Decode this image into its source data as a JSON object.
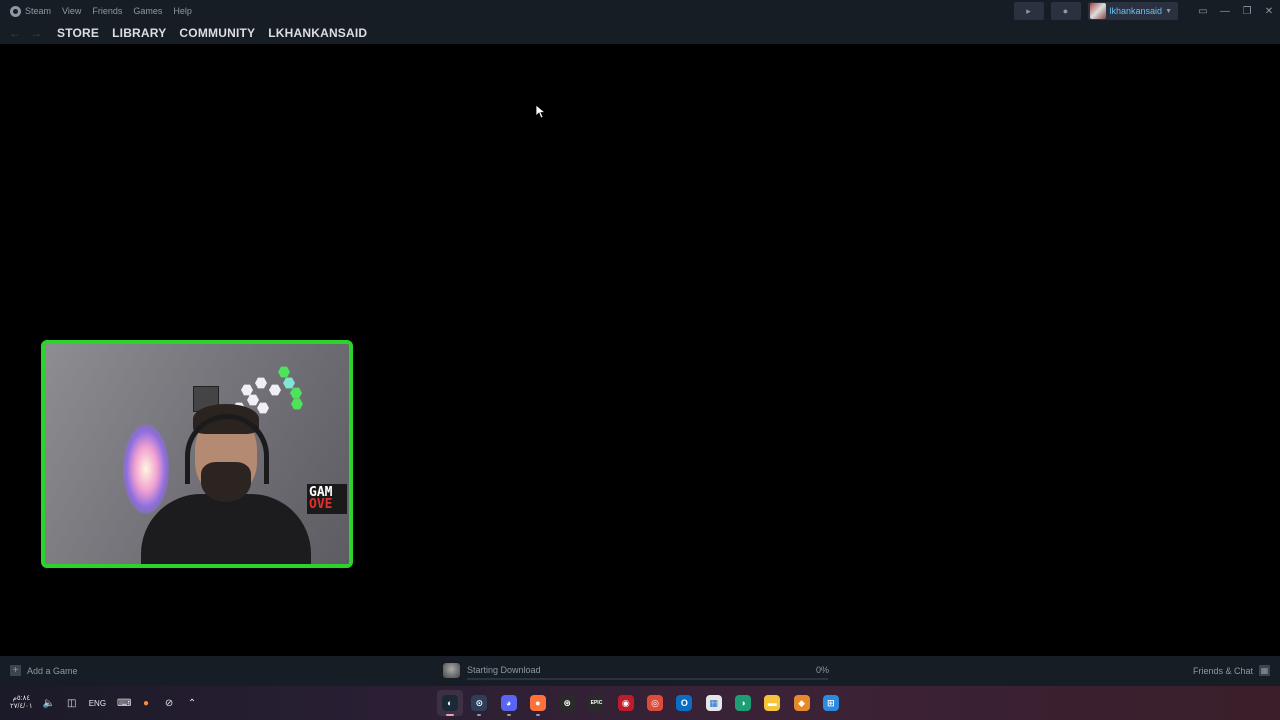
{
  "menubar": {
    "app_name": "Steam",
    "items": [
      "View",
      "Friends",
      "Games",
      "Help"
    ],
    "account_name": "lkhankansaid",
    "icons": [
      "megaphone-icon",
      "bell-icon",
      "big-picture-icon",
      "minimize-icon",
      "maximize-icon",
      "close-icon"
    ]
  },
  "navbar": {
    "back_icon": "←",
    "forward_icon": "→",
    "links": [
      "STORE",
      "LIBRARY",
      "COMMUNITY",
      "LKHANKANSAID"
    ]
  },
  "webcam": {
    "sign_line1": "GAM",
    "sign_line2": "OVE",
    "border_color": "#2bd42b"
  },
  "statusbar": {
    "add_game_label": "Add a Game",
    "download_label": "Starting Download",
    "download_percent": "0%",
    "download_progress": 0,
    "friends_label": "Friends & Chat"
  },
  "taskbar": {
    "clock_line1": "٥:٨٤م",
    "clock_line2": "٢٧/٤/٠١",
    "language": "ENG",
    "apps": [
      {
        "name": "steam",
        "color": "#1b2838",
        "glyph": "◐",
        "state": "active"
      },
      {
        "name": "controller",
        "color": "#2f3f5a",
        "glyph": "⊙",
        "state": "open"
      },
      {
        "name": "discord",
        "color": "#5865f2",
        "glyph": "◕",
        "state": "open"
      },
      {
        "name": "firefox",
        "color": "#ff7139",
        "glyph": "●",
        "state": "open"
      },
      {
        "name": "xbox",
        "color": "#2a2a2a",
        "glyph": "⊛",
        "state": ""
      },
      {
        "name": "epic",
        "color": "#2a2a2a",
        "glyph": "EPIC",
        "state": ""
      },
      {
        "name": "opera",
        "color": "#c01b2a",
        "glyph": "◉",
        "state": ""
      },
      {
        "name": "chrome",
        "color": "#dd4b39",
        "glyph": "◎",
        "state": ""
      },
      {
        "name": "outlook",
        "color": "#0a6dc5",
        "glyph": "O",
        "state": ""
      },
      {
        "name": "store",
        "color": "#e6e6e6",
        "glyph": "▦",
        "state": ""
      },
      {
        "name": "edge",
        "color": "#1e9e73",
        "glyph": "◑",
        "state": ""
      },
      {
        "name": "explorer",
        "color": "#f5c33a",
        "glyph": "▬",
        "state": ""
      },
      {
        "name": "copilot",
        "color": "#e58a2c",
        "glyph": "◆",
        "state": ""
      },
      {
        "name": "windows",
        "color": "#2a8be0",
        "glyph": "⊞",
        "state": ""
      }
    ]
  }
}
